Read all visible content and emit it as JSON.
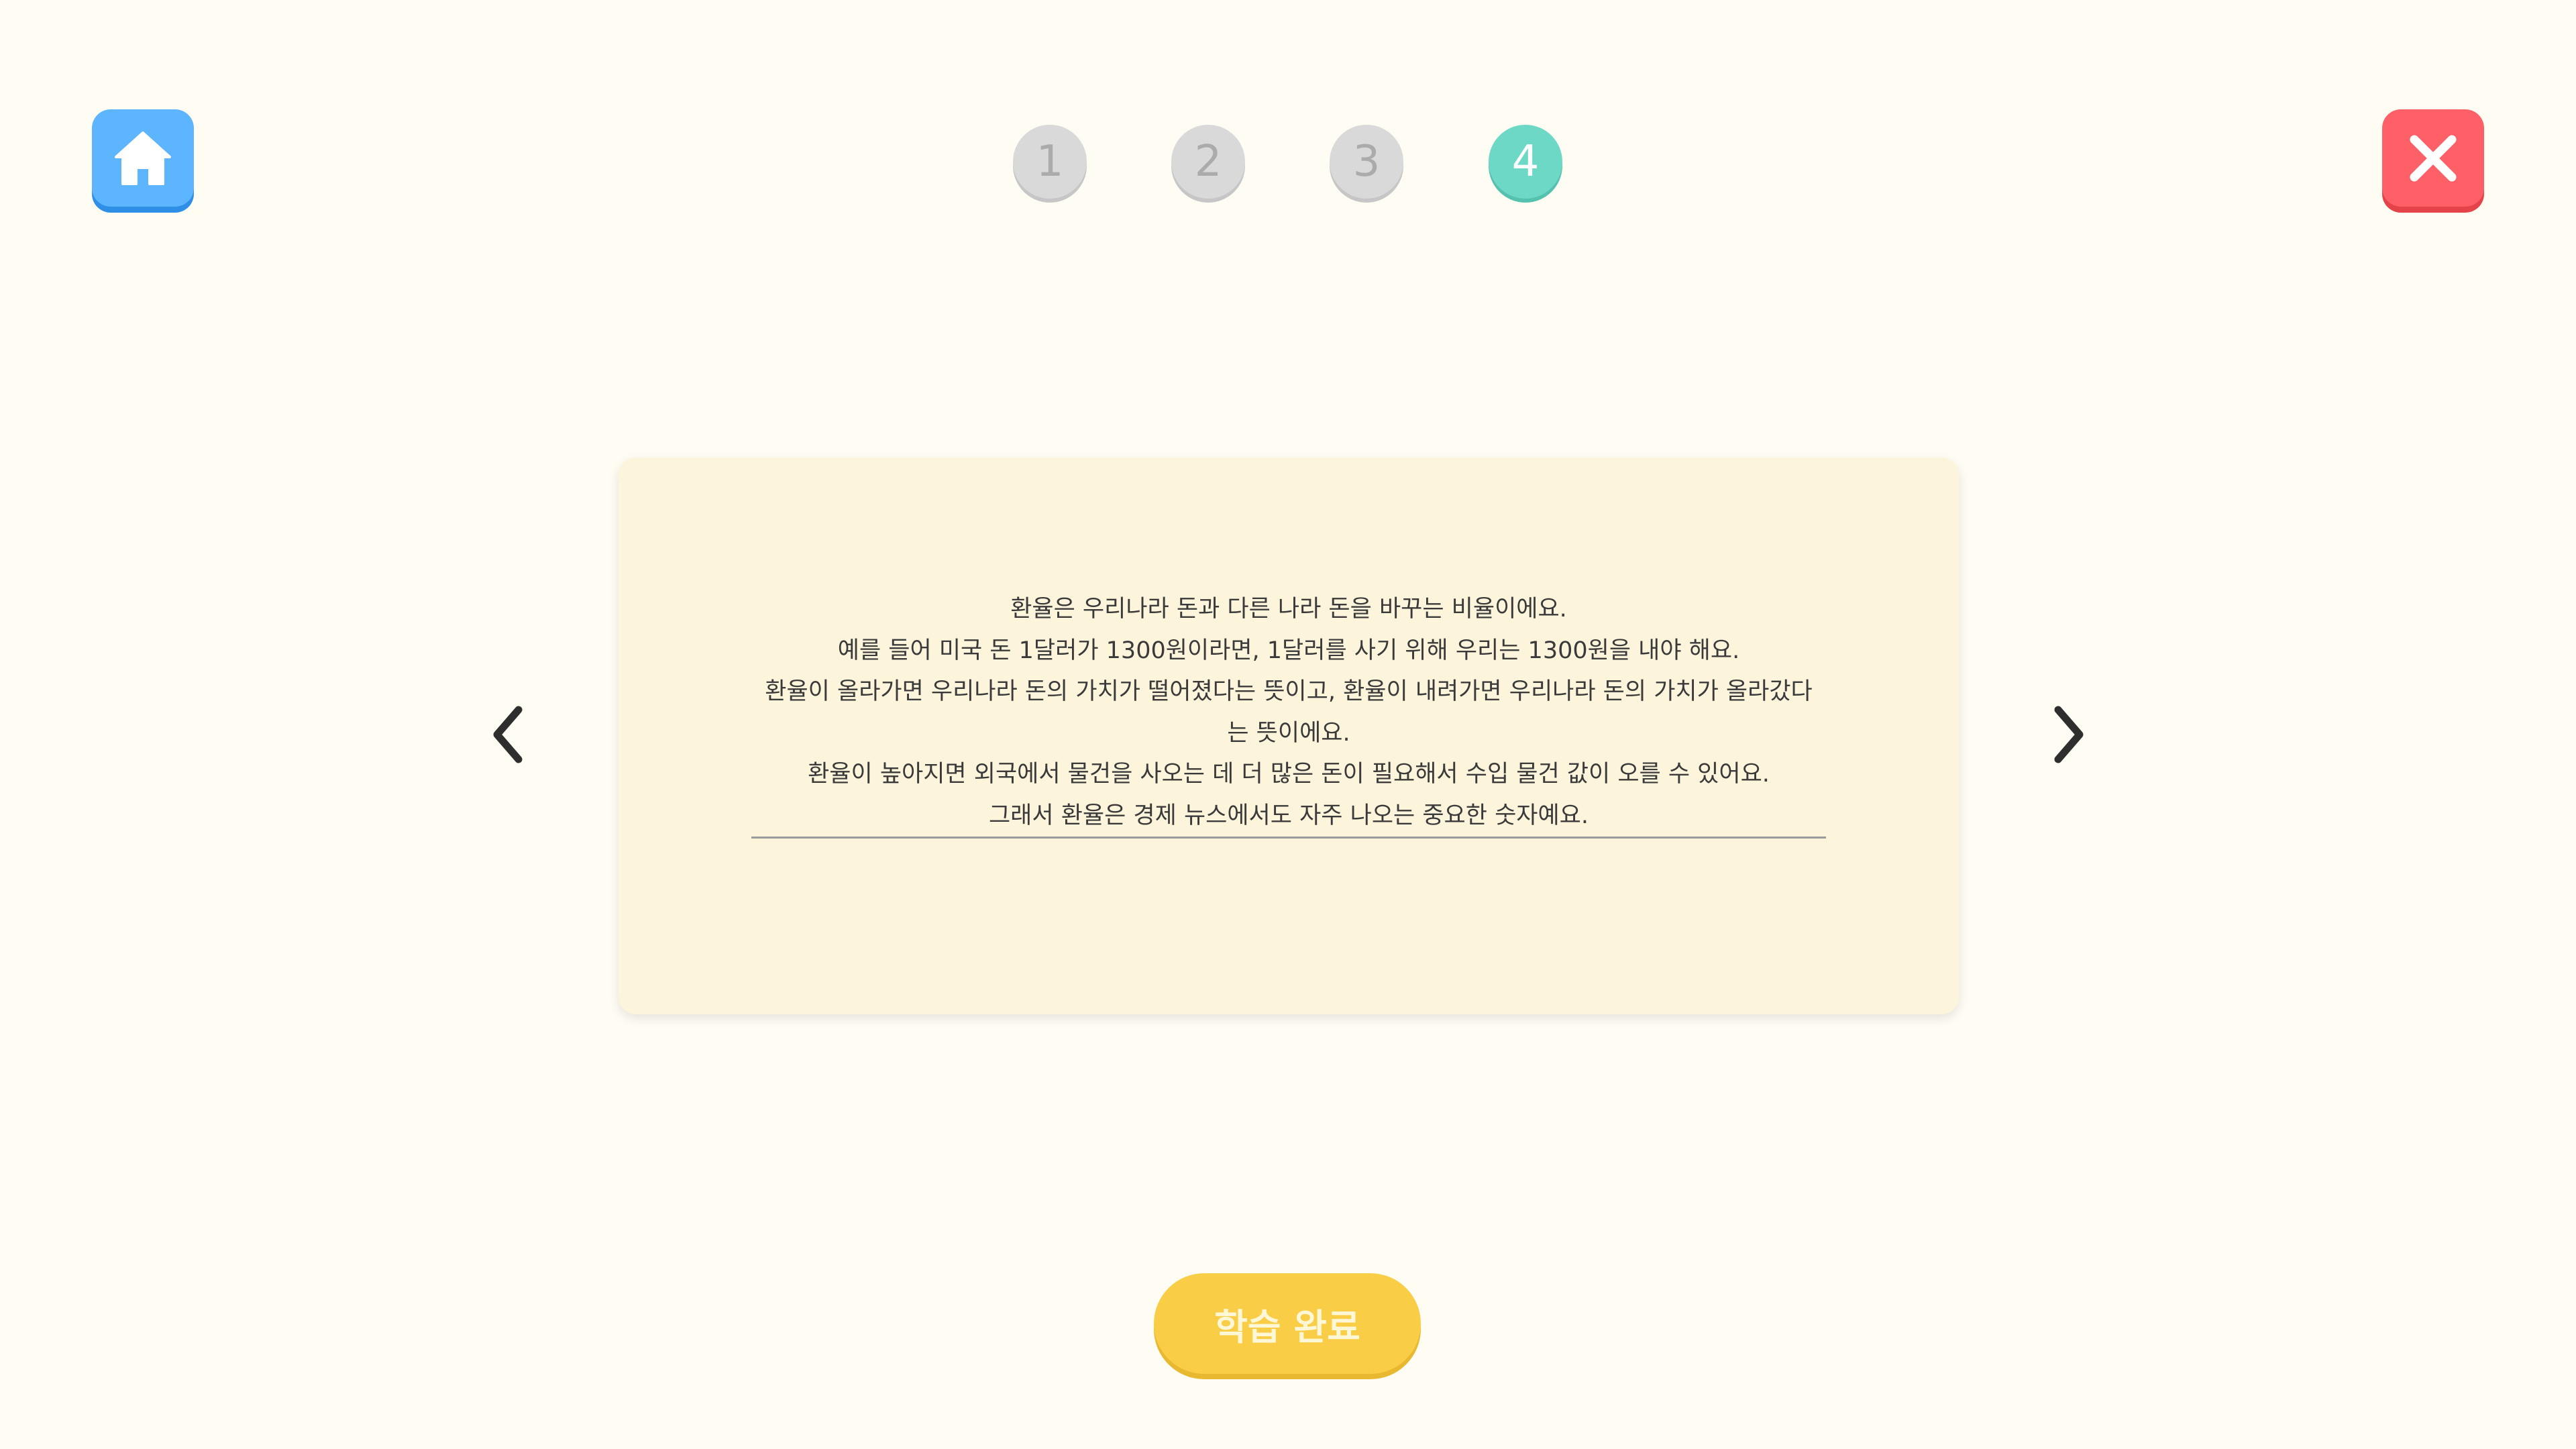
{
  "header": {
    "home_icon": "home-icon",
    "close_icon": "close-icon",
    "steps": [
      {
        "label": "1",
        "active": false
      },
      {
        "label": "2",
        "active": false
      },
      {
        "label": "3",
        "active": false
      },
      {
        "label": "4",
        "active": true
      }
    ]
  },
  "navigation": {
    "prev_icon": "chevron-left-icon",
    "next_icon": "chevron-right-icon"
  },
  "card": {
    "lines": [
      "환율은 우리나라 돈과 다른 나라 돈을 바꾸는 비율이에요.",
      "예를 들어 미국 돈 1달러가 1300원이라면, 1달러를 사기 위해 우리는 1300원을 내야 해요.",
      "환율이 올라가면 우리나라 돈의 가치가 떨어졌다는 뜻이고, 환율이 내려가면 우리나라 돈의 가치가 올라갔다",
      "는 뜻이에요.",
      "환율이 높아지면 외국에서 물건을 사오는 데 더 많은 돈이 필요해서 수입 물건 값이 오를 수 있어요.",
      "그래서 환율은 경제 뉴스에서도 자주 나오는 중요한 숫자예요."
    ]
  },
  "footer": {
    "complete_label": "학습 완료"
  },
  "colors": {
    "background": "#fffcf3",
    "home": "#5db4ff",
    "close": "#ff5f66",
    "step_active": "#6ed8c7",
    "step_inactive": "#d9d9d9",
    "card": "#fcf5dc",
    "complete": "#f9ce46"
  }
}
